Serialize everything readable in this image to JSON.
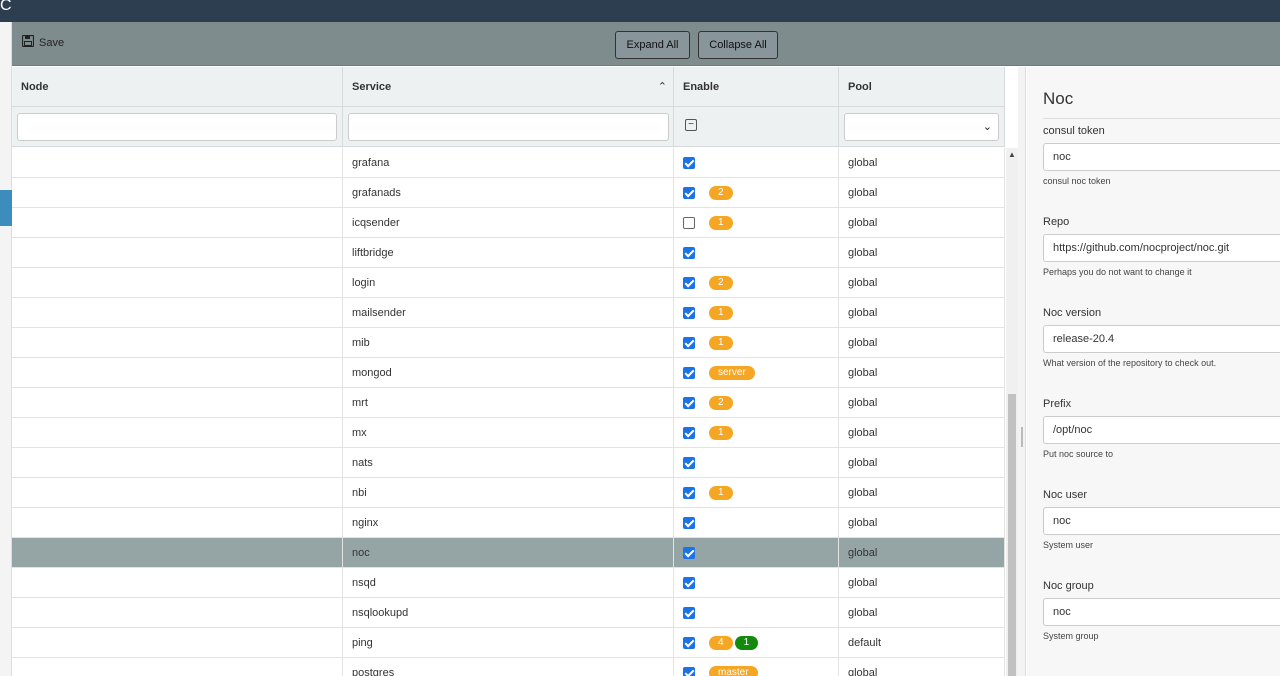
{
  "topbar": {
    "glyph": "C"
  },
  "toolbar": {
    "save_label": "Save",
    "expand_all_label": "Expand All",
    "collapse_all_label": "Collapse All"
  },
  "grid": {
    "columns": [
      "Node",
      "Service",
      "Enable",
      "Pool"
    ],
    "rows": [
      {
        "node": "",
        "service": "grafana",
        "enabled": true,
        "badges": [],
        "pool": "global"
      },
      {
        "node": "",
        "service": "grafanads",
        "enabled": true,
        "badges": [
          {
            "text": "2",
            "color": "orange"
          }
        ],
        "pool": "global"
      },
      {
        "node": "",
        "service": "icqsender",
        "enabled": false,
        "badges": [
          {
            "text": "1",
            "color": "orange"
          }
        ],
        "pool": "global"
      },
      {
        "node": "",
        "service": "liftbridge",
        "enabled": true,
        "badges": [],
        "pool": "global"
      },
      {
        "node": "",
        "service": "login",
        "enabled": true,
        "badges": [
          {
            "text": "2",
            "color": "orange"
          }
        ],
        "pool": "global"
      },
      {
        "node": "",
        "service": "mailsender",
        "enabled": true,
        "badges": [
          {
            "text": "1",
            "color": "orange"
          }
        ],
        "pool": "global"
      },
      {
        "node": "",
        "service": "mib",
        "enabled": true,
        "badges": [
          {
            "text": "1",
            "color": "orange"
          }
        ],
        "pool": "global"
      },
      {
        "node": "",
        "service": "mongod",
        "enabled": true,
        "badges": [
          {
            "text": "server",
            "color": "orange"
          }
        ],
        "pool": "global"
      },
      {
        "node": "",
        "service": "mrt",
        "enabled": true,
        "badges": [
          {
            "text": "2",
            "color": "orange"
          }
        ],
        "pool": "global"
      },
      {
        "node": "",
        "service": "mx",
        "enabled": true,
        "badges": [
          {
            "text": "1",
            "color": "orange"
          }
        ],
        "pool": "global"
      },
      {
        "node": "",
        "service": "nats",
        "enabled": true,
        "badges": [],
        "pool": "global"
      },
      {
        "node": "",
        "service": "nbi",
        "enabled": true,
        "badges": [
          {
            "text": "1",
            "color": "orange"
          }
        ],
        "pool": "global"
      },
      {
        "node": "",
        "service": "nginx",
        "enabled": true,
        "badges": [],
        "pool": "global"
      },
      {
        "node": "",
        "service": "noc",
        "enabled": true,
        "badges": [],
        "pool": "global",
        "selected": true
      },
      {
        "node": "",
        "service": "nsqd",
        "enabled": true,
        "badges": [],
        "pool": "global"
      },
      {
        "node": "",
        "service": "nsqlookupd",
        "enabled": true,
        "badges": [],
        "pool": "global"
      },
      {
        "node": "",
        "service": "ping",
        "enabled": true,
        "badges": [
          {
            "text": "4",
            "color": "orange"
          },
          {
            "text": "1",
            "color": "green"
          }
        ],
        "pool": "default"
      },
      {
        "node": "",
        "service": "postgres",
        "enabled": true,
        "badges": [
          {
            "text": "master",
            "color": "orange"
          }
        ],
        "pool": "global"
      }
    ]
  },
  "panel": {
    "title": "Noc",
    "fields": [
      {
        "label": "consul token",
        "value": "noc",
        "help": "consul noc token"
      },
      {
        "label": "Repo",
        "value": "https://github.com/nocproject/noc.git",
        "help": "Perhaps you do not want to change it"
      },
      {
        "label": "Noc version",
        "value": "release-20.4",
        "help": "What version of the repository to check out."
      },
      {
        "label": "Prefix",
        "value": "/opt/noc",
        "help": "Put noc source to"
      },
      {
        "label": "Noc user",
        "value": "noc",
        "help": "System user"
      },
      {
        "label": "Noc group",
        "value": "noc",
        "help": "System group"
      }
    ]
  },
  "colors": {
    "toolbar": "#7f8c8d",
    "selected_row": "#95a5a6",
    "badge_orange": "#f5a623",
    "badge_green": "#128a0e",
    "checkbox": "#1a73e8"
  }
}
